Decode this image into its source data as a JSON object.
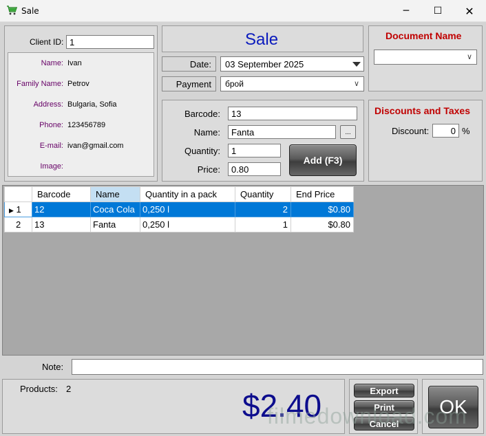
{
  "window": {
    "title": "Sale",
    "minimize": "─",
    "maximize": "☐",
    "close": "✕"
  },
  "client": {
    "client_id_label": "Client ID:",
    "client_id_value": "1",
    "fields": [
      {
        "label": "Name:",
        "value": "Ivan"
      },
      {
        "label": "Family Name:",
        "value": "Petrov"
      },
      {
        "label": "Address:",
        "value": "Bulgaria, Sofia"
      },
      {
        "label": "Phone:",
        "value": "123456789"
      },
      {
        "label": "E-mail:",
        "value": "ivan@gmail.com"
      },
      {
        "label": "Image:",
        "value": ""
      }
    ]
  },
  "sale": {
    "heading": "Sale",
    "date_label": "Date:",
    "date_value": "03 September 2025",
    "payment_label": "Payment",
    "payment_value": "брой"
  },
  "document": {
    "heading": "Document Name",
    "value": ""
  },
  "product": {
    "barcode_label": "Barcode:",
    "barcode_value": "13",
    "name_label": "Name:",
    "name_value": "Fanta",
    "browse_label": "...",
    "quantity_label": "Quantity:",
    "quantity_value": "1",
    "price_label": "Price:",
    "price_value": "0.80",
    "add_label": "Add (F3)"
  },
  "discounts": {
    "heading": "Discounts and Taxes",
    "discount_label": "Discount:",
    "discount_value": "0",
    "percent": "%"
  },
  "table": {
    "columns": [
      "Barcode",
      "Name",
      "Quantity in a pack",
      "Quantity",
      "End Price"
    ],
    "rows": [
      {
        "num": "1",
        "barcode": "12",
        "name": "Coca Cola",
        "pack": "0,250 l",
        "qty": "2",
        "price": "$0.80"
      },
      {
        "num": "2",
        "barcode": "13",
        "name": "Fanta",
        "pack": "0,250 l",
        "qty": "1",
        "price": "$0.80"
      }
    ]
  },
  "note": {
    "label": "Note:",
    "value": ""
  },
  "summary": {
    "products_label": "Products:",
    "products_count": "2",
    "total": "$2.40"
  },
  "actions": {
    "export": "Export",
    "print": "Print",
    "cancel": "Cancel",
    "ok": "OK"
  },
  "watermark": "filmedownload.com",
  "colors": {
    "heading_blue": "#0b1bbd",
    "heading_red": "#c00000",
    "selection": "#0078d7",
    "total": "#0d0d8d"
  }
}
